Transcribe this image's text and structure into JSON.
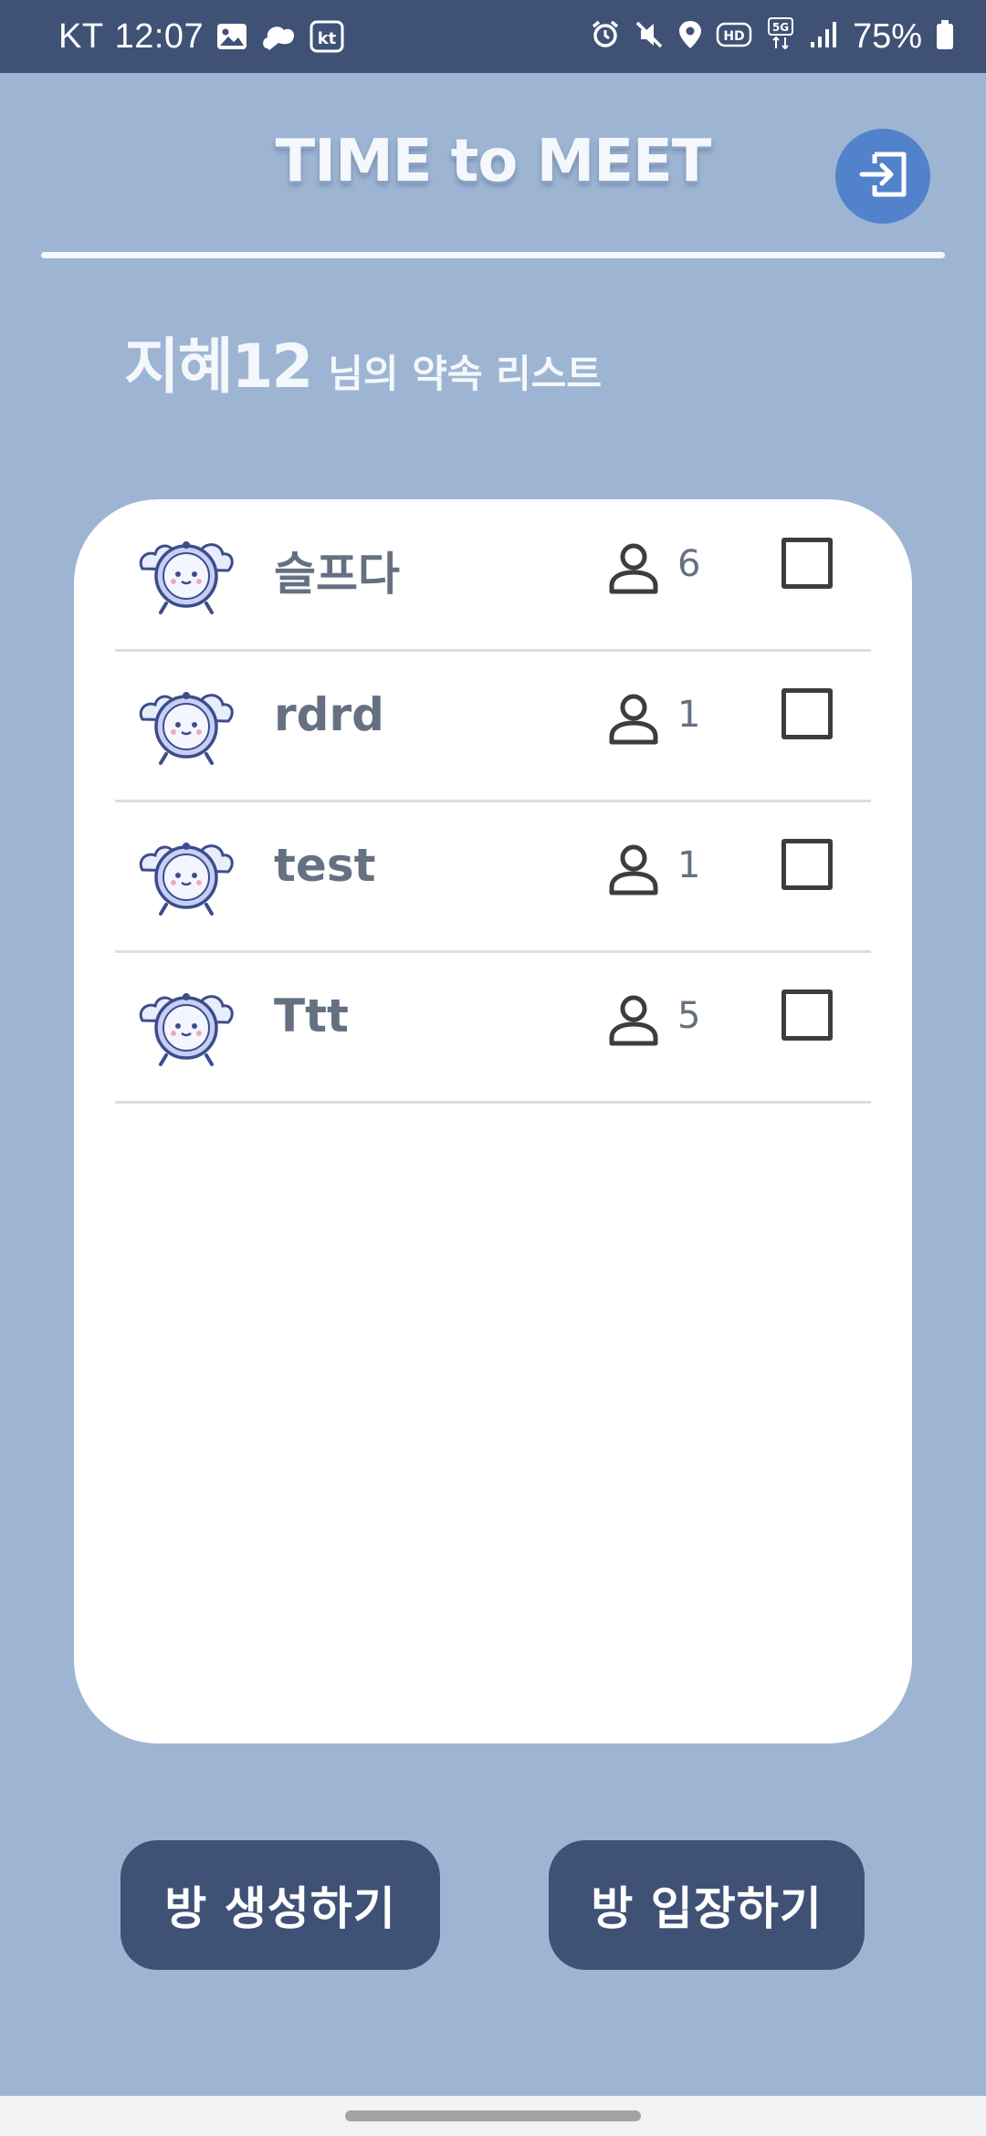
{
  "status_bar": {
    "carrier": "KT",
    "time": "12:07",
    "left_icons": [
      "image-icon",
      "cloud-app-icon",
      "kt-app-icon"
    ],
    "right_icons": [
      "alarm-icon",
      "mute-icon",
      "location-icon",
      "hd-voice-icon",
      "5g-icon",
      "signal-icon"
    ],
    "battery": "75%"
  },
  "header": {
    "title": "TIME to MEET",
    "logout_icon": "login-arrow-icon"
  },
  "greeting": {
    "username": "지혜12",
    "suffix": "님의 약속 리스트"
  },
  "rooms": [
    {
      "name": "슬프다",
      "members": "6",
      "checked": false
    },
    {
      "name": "rdrd",
      "members": "1",
      "checked": false
    },
    {
      "name": "test",
      "members": "1",
      "checked": false
    },
    {
      "name": "Ttt",
      "members": "5",
      "checked": false
    }
  ],
  "buttons": {
    "create": "방 생성하기",
    "enter": "방 입장하기"
  },
  "colors": {
    "background": "#9db5d3",
    "status_bar": "#3f5175",
    "accent_button": "#5282cc",
    "primary_button": "#3f5175",
    "card": "#ffffff",
    "list_text": "#657181"
  }
}
